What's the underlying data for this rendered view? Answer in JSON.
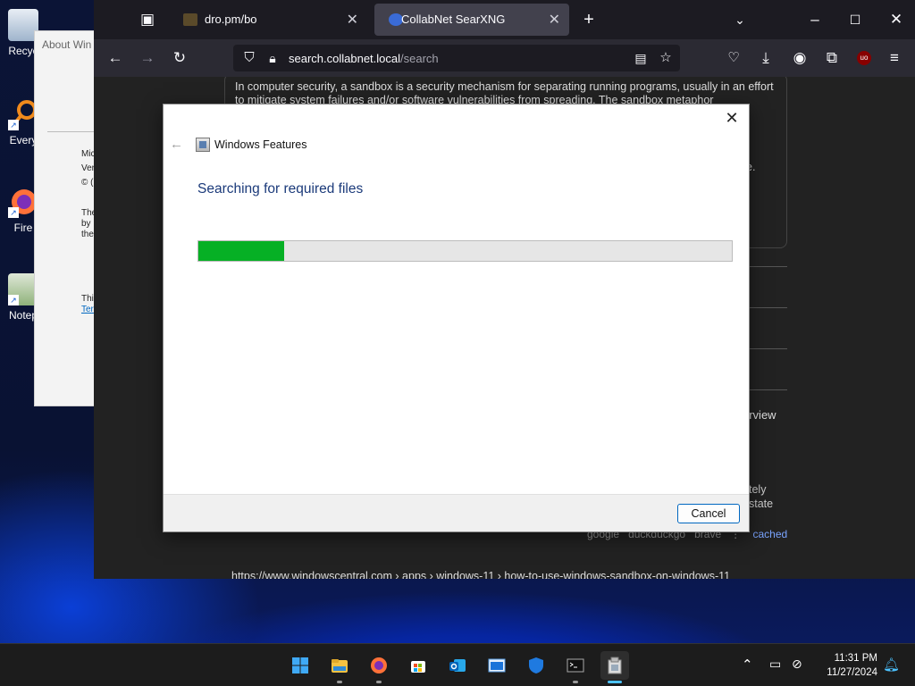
{
  "desktop": {
    "icons": [
      {
        "label": "Recyc",
        "icon": "recycle-bin-icon"
      },
      {
        "label": "Every",
        "icon": "everything-search-icon"
      },
      {
        "label": "Fire",
        "icon": "firefox-icon"
      },
      {
        "label": "Notep",
        "icon": "notepad-icon"
      }
    ]
  },
  "about_window": {
    "title": "About Win",
    "lines": [
      "Mic",
      "Ver",
      "© (",
      "The",
      "by",
      "the",
      "Thi",
      "Ter"
    ]
  },
  "browser": {
    "tabs": [
      {
        "label": "dro.pm/bo",
        "active": false
      },
      {
        "label": "CollabNet SearXNG",
        "active": true
      }
    ],
    "url_host": "search.collabnet.local",
    "url_path": "/search",
    "snippet": "In computer security, a sandbox is a security mechanism for separating running programs, usually in an effort to mitigate system failures and/or software vulnerabilities from spreading. The sandbox metaphor",
    "fragments": {
      "r1": "r",
      "e1": "e.",
      "overview": "erview",
      "tely": "tely",
      "state": "state"
    },
    "engines": [
      "google",
      "duckduckgo",
      "brave",
      "cached"
    ],
    "next_url": "https://www.windowscentral.com › apps › windows-11 › how-to-use-windows-sandbox-on-windows-11"
  },
  "dialog": {
    "title": "Windows Features",
    "status": "Searching for required files",
    "progress": 0.16,
    "cancel_label": "Cancel"
  },
  "taskbar": {
    "apps": [
      "start-icon",
      "file-explorer-icon",
      "firefox-icon",
      "microsoft-store-icon",
      "outlook-icon",
      "sandbox-icon",
      "windows-security-icon",
      "terminal-icon",
      "installer-icon"
    ],
    "time": "11:31 PM",
    "date": "11/27/2024"
  },
  "colors": {
    "accent": "#0067c0",
    "progress_fill": "#06b025",
    "link": "#7aa4ff"
  }
}
